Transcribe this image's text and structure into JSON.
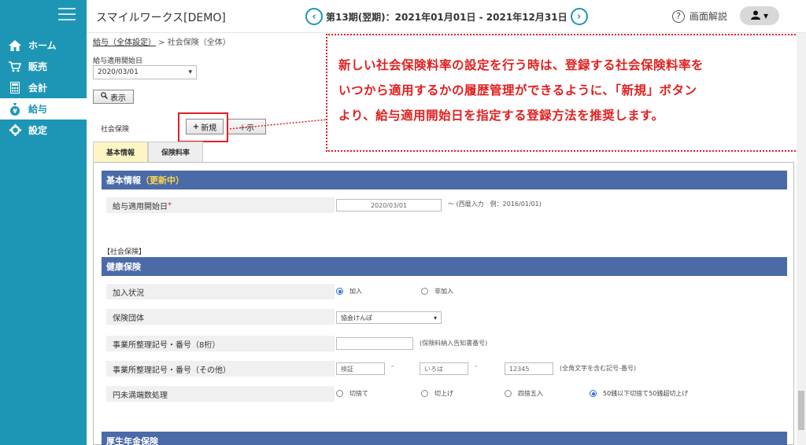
{
  "app": {
    "title": "スマイルワークス[DEMO]"
  },
  "period": {
    "text": "第13期(翌期)：2021年01月01日 - 2021年12月31日",
    "prev": "‹",
    "next": "›"
  },
  "help": {
    "q": "?",
    "label": "画面解説"
  },
  "user": {
    "icon": "👤",
    "caret": "▾"
  },
  "sidebar": {
    "items": [
      {
        "label": "ホーム",
        "icon": "home-icon"
      },
      {
        "label": "販売",
        "icon": "cart-icon"
      },
      {
        "label": "会計",
        "icon": "calculator-icon"
      },
      {
        "label": "給与",
        "icon": "money-bag-icon",
        "active": true
      },
      {
        "label": "設定",
        "icon": "gear-icon"
      }
    ]
  },
  "breadcrumb": {
    "link": "給与（全体設定）",
    "sep": " > ",
    "current": "社会保険（全体）"
  },
  "filter": {
    "date_label": "給与適用開始日",
    "date_value": "2020/03/01",
    "show_button": "表示",
    "insurance_label": "社会保険",
    "new_button": "新規",
    "other_button_partial": "＋示"
  },
  "tabs": [
    {
      "label": "基本情報",
      "active": true
    },
    {
      "label": "保険料率",
      "active": false
    }
  ],
  "basic_info": {
    "title": "基本情報",
    "status": "（更新中）",
    "start_date_label": "給与適用開始日",
    "required_mark": "*",
    "start_date_value": "2020/03/01",
    "start_date_hint": "～ (西暦入力　例：2016/01/01)"
  },
  "social_insurance_label": "【社会保険】",
  "health": {
    "title": "健康保険",
    "enroll_label": "加入状況",
    "enroll_options": [
      "加入",
      "非加入"
    ],
    "enroll_selected": 0,
    "group_label": "保険団体",
    "group_value": "協会けんぽ",
    "office_no_label": "事業所整理記号・番号（8桁）",
    "office_no_hint": "(保険料納入告知書番号)",
    "office_other_label": "事業所整理記号・番号（その他）",
    "office_other_placeholders": [
      "検証",
      "いろは",
      "12345"
    ],
    "office_other_hint": "(全角文字を含む記号-番号)",
    "rounding_label": "円未満端数処理",
    "rounding_options": [
      "切捨て",
      "切上げ",
      "四捨五入",
      "50銭以下切捨て50銭超切上げ"
    ],
    "rounding_selected": 3
  },
  "pension": {
    "title": "厚生年金保険"
  },
  "callout": {
    "lines": [
      "新しい社会保険料率の設定を行う時は、登録する社会保険料率を",
      "いつから適用するかの履歴管理ができるように、「新規」ボタン",
      "より、給与適用開始日を指定する登録方法を推奨します。"
    ]
  },
  "colors": {
    "sidebar": "#1d96b5",
    "section": "#4a6aa8",
    "callout": "#e02020"
  }
}
